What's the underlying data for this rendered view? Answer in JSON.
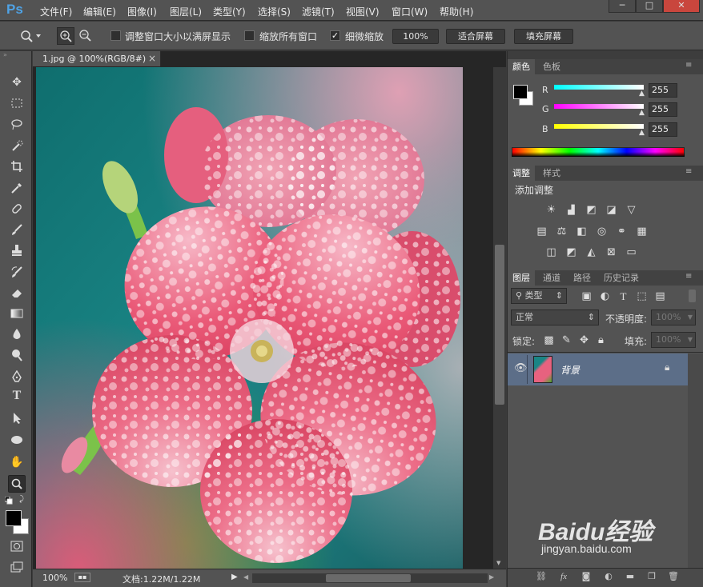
{
  "app": {
    "logo": "Ps"
  },
  "menu": [
    "文件(F)",
    "编辑(E)",
    "图像(I)",
    "图层(L)",
    "类型(Y)",
    "选择(S)",
    "滤镜(T)",
    "视图(V)",
    "窗口(W)",
    "帮助(H)"
  ],
  "window_controls": {
    "minimize": "─",
    "maximize": "□",
    "close": "✕"
  },
  "options": {
    "resize_windows_label": "调整窗口大小以满屏显示",
    "zoom_all_label": "缩放所有窗口",
    "scrubby_label": "细微缩放",
    "zoom_value": "100%",
    "fit_screen_label": "适合屏幕",
    "fill_screen_label": "填充屏幕",
    "scrubby_checked": true
  },
  "document": {
    "tab_title": "1.jpg @ 100%(RGB/8#)",
    "tab_close": "×"
  },
  "status": {
    "zoom": "100%",
    "doc_info": "文档:1.22M/1.22M"
  },
  "color_panel": {
    "tab_active": "颜色",
    "tab_inactive": "色板",
    "r_label": "R",
    "g_label": "G",
    "b_label": "B",
    "r_value": "255",
    "g_value": "255",
    "b_value": "255"
  },
  "adjust_panel": {
    "tab_active": "调整",
    "tab_inactive": "样式",
    "title": "添加调整"
  },
  "layers_panel": {
    "tabs": [
      "图层",
      "通道",
      "路径",
      "历史记录"
    ],
    "filter_label": "类型",
    "blend_mode": "正常",
    "opacity_label": "不透明度:",
    "opacity_value": "100%",
    "lock_label": "锁定:",
    "fill_label": "填充:",
    "fill_value": "100%",
    "layers": [
      {
        "name": "背景",
        "visible": true,
        "locked": true
      }
    ]
  },
  "watermark": {
    "brand": "Baidu经验",
    "url": "jingyan.baidu.com"
  },
  "colors": {
    "accent": "#4fa3e6",
    "selected_layer": "#5c6e88",
    "panel_bg": "#535353"
  }
}
